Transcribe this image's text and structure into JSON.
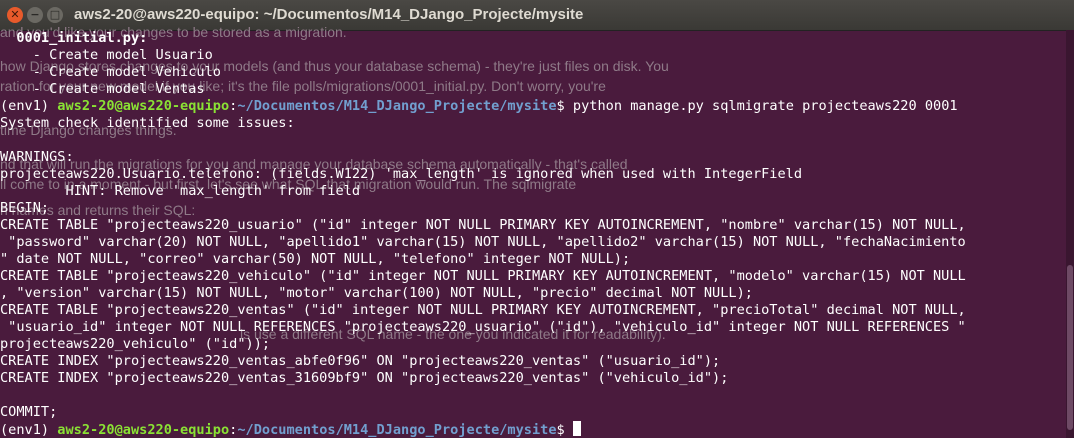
{
  "window": {
    "title": "aws2-20@aws220-equipo: ~/Documentos/M14_DJango_Projecte/mysite",
    "close_glyph": "✕",
    "minimize_glyph": "−",
    "maximize_glyph": "□"
  },
  "background_page": {
    "text_1": "and you'd like your changes to be stored as a migration.",
    "text_2": "how Django stores changes to your models (and thus your database schema) - they're just files on disk. You",
    "text_3": "ration for your new model if you like; it's the file polls/migrations/0001_initial.py. Don't worry, you're",
    "text_4": "time Django changes things.",
    "text_5": "nd that will run the migrations for you and manage your database schema automatically - that's called",
    "text_6": "ll come to in a moment - but first, let's see what SQL that migration would run. The sqlmigrate",
    "text_7": "n names and returns their SQL:",
    "text_8": "ls use a different SQL name - the one you indicated it for readability)."
  },
  "terminal": {
    "lines": [
      {
        "text": "  0001_initial.py:",
        "style": "b"
      },
      {
        "text": "    - Create model Usuario"
      },
      {
        "text": "    - Create model Vehiculo"
      },
      {
        "text": "    - Create model Ventas"
      },
      {
        "prompt": true,
        "env": "(env1) ",
        "user": "aws2-20@aws220-equipo",
        "sep": ":",
        "path": "~/Documentos/M14_DJango_Projecte/mysite",
        "dollar": "$ ",
        "command": "python manage.py sqlmigrate projecteaws220 0001"
      },
      {
        "text": "System check identified some issues:"
      },
      {
        "text": ""
      },
      {
        "text": "WARNINGS:"
      },
      {
        "text": "projecteaws220.Usuario.telefono: (fields.W122) 'max_length' is ignored when used with IntegerField"
      },
      {
        "text": "        HINT: Remove 'max_length' from field"
      },
      {
        "text": "BEGIN;"
      },
      {
        "text": "CREATE TABLE \"projecteaws220_usuario\" (\"id\" integer NOT NULL PRIMARY KEY AUTOINCREMENT, \"nombre\" varchar(15) NOT NULL,"
      },
      {
        "text": " \"password\" varchar(20) NOT NULL, \"apellido1\" varchar(15) NOT NULL, \"apellido2\" varchar(15) NOT NULL, \"fechaNacimiento"
      },
      {
        "text": "\" date NOT NULL, \"correo\" varchar(50) NOT NULL, \"telefono\" integer NOT NULL);"
      },
      {
        "text": "CREATE TABLE \"projecteaws220_vehiculo\" (\"id\" integer NOT NULL PRIMARY KEY AUTOINCREMENT, \"modelo\" varchar(15) NOT NULL"
      },
      {
        "text": ", \"version\" varchar(15) NOT NULL, \"motor\" varchar(100) NOT NULL, \"precio\" decimal NOT NULL);"
      },
      {
        "text": "CREATE TABLE \"projecteaws220_ventas\" (\"id\" integer NOT NULL PRIMARY KEY AUTOINCREMENT, \"precioTotal\" decimal NOT NULL,"
      },
      {
        "text": " \"usuario_id\" integer NOT NULL REFERENCES \"projecteaws220_usuario\" (\"id\"), \"vehiculo_id\" integer NOT NULL REFERENCES \""
      },
      {
        "text": "projecteaws220_vehiculo\" (\"id\"));"
      },
      {
        "text": "CREATE INDEX \"projecteaws220_ventas_abfe0f96\" ON \"projecteaws220_ventas\" (\"usuario_id\");"
      },
      {
        "text": "CREATE INDEX \"projecteaws220_ventas_31609bf9\" ON \"projecteaws220_ventas\" (\"vehiculo_id\");"
      },
      {
        "text": ""
      },
      {
        "text": "COMMIT;"
      },
      {
        "prompt": true,
        "cursor": true,
        "env": "(env1) ",
        "user": "aws2-20@aws220-equipo",
        "sep": ":",
        "path": "~/Documentos/M14_DJango_Projecte/mysite",
        "dollar": "$ ",
        "command": ""
      }
    ]
  },
  "colors": {
    "terminal_background": "#4a1b3d",
    "prompt_user": "#8ae234",
    "prompt_path": "#729fcf",
    "text": "#ffffff",
    "close_button": "#e85a2b"
  }
}
